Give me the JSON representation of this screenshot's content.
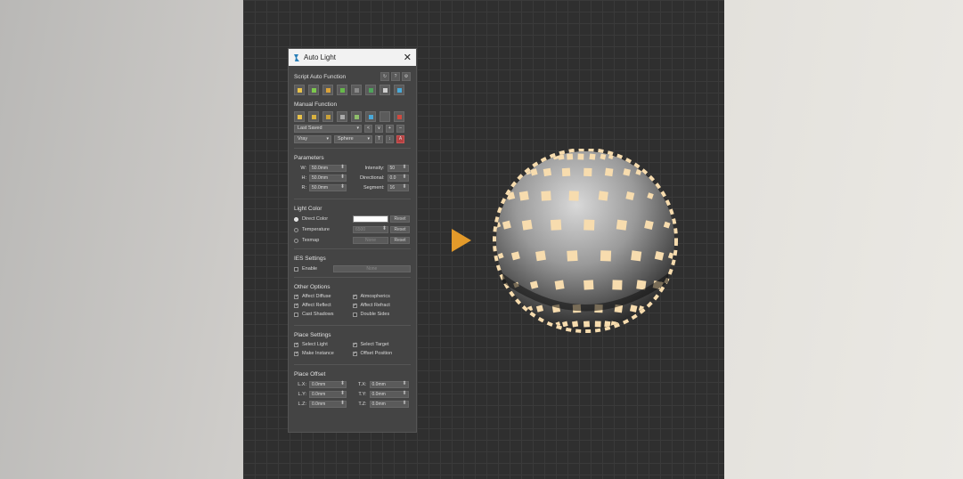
{
  "window": {
    "title": "Auto Light",
    "close_icon": "close-icon",
    "logo_icon": "auto-light-logo-icon"
  },
  "script_auto": {
    "label": "Script Auto Function",
    "mini_buttons": [
      "↻",
      "?",
      "⚙"
    ]
  },
  "manual": {
    "label": "Manual Function"
  },
  "presets": {
    "selected": "Last Saved",
    "nav": [
      "<",
      "∨",
      "+",
      "–"
    ]
  },
  "renderer": {
    "selected": "Vray",
    "shape": "Sphere",
    "extra": [
      "T",
      "↕",
      "A"
    ]
  },
  "parameters": {
    "label": "Parameters",
    "w_label": "W:",
    "w_value": "50.0mm",
    "h_label": "H:",
    "h_value": "50.0mm",
    "r_label": "R:",
    "r_value": "50.0mm",
    "intensity_label": "Intensity:",
    "intensity_value": "50",
    "directional_label": "Directional:",
    "directional_value": "0.0",
    "segment_label": "Segment:",
    "segment_value": "16"
  },
  "light_color": {
    "label": "Light Color",
    "direct_label": "Direct Color",
    "temperature_label": "Temperature",
    "temperature_value": "6500",
    "texmap_label": "Texmap",
    "texmap_value": "None",
    "reset_label": "Reset",
    "swatch_color": "#ffffff"
  },
  "ies": {
    "label": "IES Settings",
    "enable_label": "Enable",
    "file_value": "None"
  },
  "other": {
    "label": "Other Options",
    "affect_diffuse": "Affect Diffuse",
    "atmospherics": "Atmospherics",
    "affect_reflect": "Affect Reflect",
    "affect_refract": "Affect Refract",
    "cast_shadows": "Cast Shadows",
    "double_sides": "Double Sides"
  },
  "place": {
    "label": "Place Settings",
    "select_light": "Select Light",
    "select_target": "Select Target",
    "make_instance": "Make Instance",
    "offset_position": "Offset Position"
  },
  "offset": {
    "label": "Place Offset",
    "lx_label": "L.X:",
    "ly_label": "L.Y:",
    "lz_label": "L.Z:",
    "tx_label": "T.X:",
    "ty_label": "T.Y:",
    "tz_label": "T.Z:",
    "lx": "0.0mm",
    "ly": "0.0mm",
    "lz": "0.0mm",
    "tx": "0.0mm",
    "ty": "0.0mm",
    "tz": "0.0mm"
  },
  "colors": {
    "accent_arrow": "#e39a2a",
    "light_tile": "#f7dcae"
  }
}
